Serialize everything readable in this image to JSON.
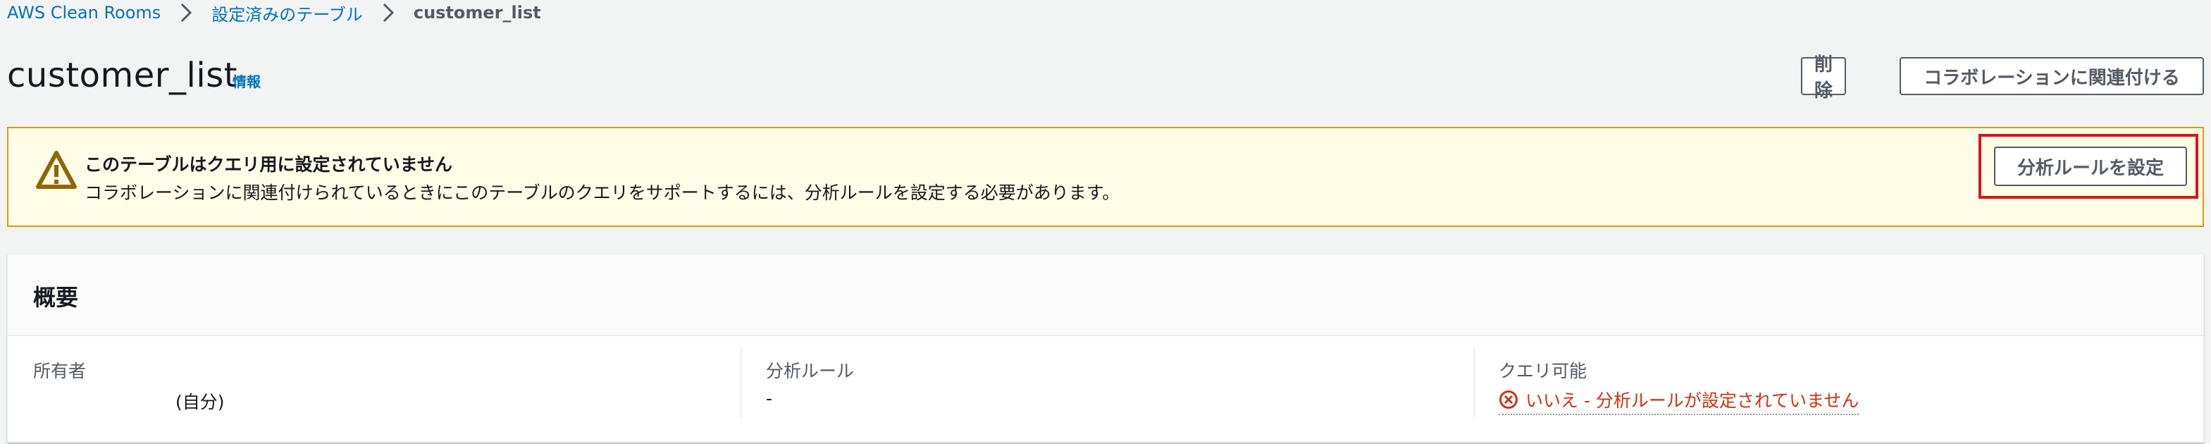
{
  "breadcrumb": {
    "items": [
      "AWS Clean Rooms",
      "設定済みのテーブル"
    ],
    "current": "customer_list"
  },
  "header": {
    "title": "customer_list",
    "info_label": "情報",
    "delete_label": "削除",
    "associate_label": "コラボレーションに関連付ける"
  },
  "alert": {
    "title": "このテーブルはクエリ用に設定されていません",
    "message": "コラボレーションに関連付けられているときにこのテーブルのクエリをサポートするには、分析ルールを設定する必要があります。",
    "action_label": "分析ルールを設定",
    "icon": "warning-icon",
    "accent_color": "#8d6605"
  },
  "overview": {
    "title": "概要",
    "owner": {
      "label": "所有者",
      "value": "(自分)"
    },
    "analysis_rule": {
      "label": "分析ルール",
      "value": "-"
    },
    "queryable": {
      "label": "クエリ可能",
      "value": "いいえ - 分析ルールが設定されていません",
      "icon": "error-circle-icon",
      "color": "#d13212"
    }
  }
}
